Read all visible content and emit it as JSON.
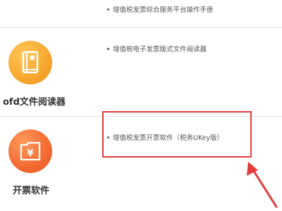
{
  "top_item": {
    "link_label": "增值税发票综合服务平台操作手册"
  },
  "ofd_reader": {
    "title": "ofd文件阅读器",
    "link_label": "增值税电子发票版式文件阅读器",
    "icon": "book-icon",
    "icon_color": "#f7a62e"
  },
  "invoicing_software": {
    "title": "开票软件",
    "link_label": "增值税发票开票软件（税务UKey版）",
    "icon": "yuan-folder-icon",
    "icon_color": "#f26a32"
  },
  "colors": {
    "highlight": "#e43b3b",
    "divider": "#e2e2e2",
    "text": "#333333"
  }
}
